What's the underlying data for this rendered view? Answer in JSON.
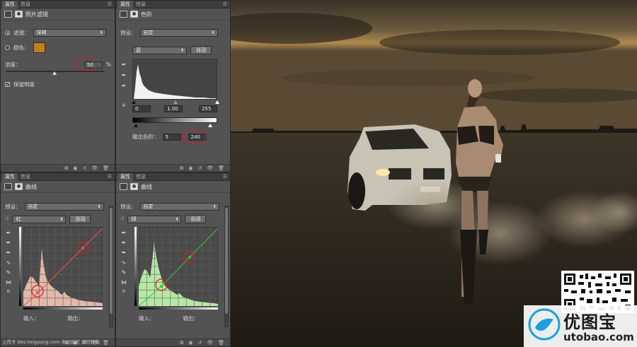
{
  "panels": {
    "photo_filter": {
      "tabs": [
        "属性",
        "信息"
      ],
      "title": "照片滤镜",
      "filter_label": "滤镜：",
      "filter_value": "深褐",
      "color_label": "颜色：",
      "color_value": "#c17e1f",
      "density_label": "浓度：",
      "density_value": "50",
      "density_unit": "%",
      "preserve_label": "保留明度"
    },
    "levels": {
      "tabs": [
        "属性",
        "信息"
      ],
      "title": "色阶",
      "preset_label": "预设：",
      "preset_value": "自定",
      "channel_value": "蓝",
      "auto_label": "自动",
      "input_values": [
        "0",
        "1.00",
        "255"
      ],
      "output_label": "输出色阶：",
      "output_low": "5",
      "output_high": "240"
    },
    "curves_red": {
      "tabs": [
        "属性",
        "信息"
      ],
      "title": "曲线",
      "preset_label": "预设：",
      "preset_value": "自定",
      "channel_value": "红",
      "auto_label": "自动",
      "input_label": "输入：",
      "output_label": "输出：",
      "curve_color": "#e05a4a"
    },
    "curves_green": {
      "tabs": [
        "属性",
        "信息"
      ],
      "title": "曲线",
      "preset_label": "预设：",
      "preset_value": "自定",
      "channel_value": "绿",
      "auto_label": "自动",
      "input_label": "输入：",
      "output_label": "输出：",
      "curve_color": "#3cc43c"
    }
  },
  "footer_text": "上传于 bbs.heiguang.com  未经授权  请勿转载",
  "logo": {
    "brand_cn": "优图宝",
    "brand_url": "utobao.com"
  },
  "accent_colors": {
    "highlight_ring": "#d21e1e",
    "filter_color": "#c17e1f"
  }
}
